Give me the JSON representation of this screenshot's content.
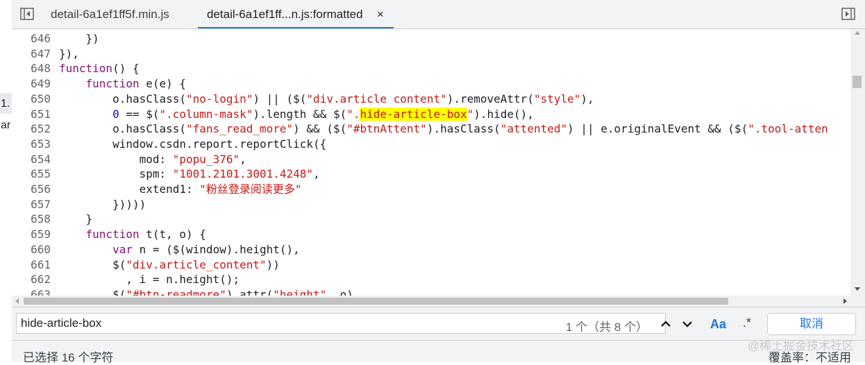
{
  "tabs": [
    {
      "label": "detail-6a1ef1ff5f.min.js",
      "active": false
    },
    {
      "label": "detail-6a1ef1ff...n.js:formatted",
      "active": true,
      "close": "×"
    }
  ],
  "left_strip": {
    "item1": "1.",
    "item2": "ar"
  },
  "code_lines": [
    {
      "n": "646",
      "html": "    })"
    },
    {
      "n": "647",
      "html": "}),"
    },
    {
      "n": "648",
      "html": "<span class=\"kw\">function</span>() {"
    },
    {
      "n": "649",
      "html": "    <span class=\"kw\">function</span> e(e) {"
    },
    {
      "n": "650",
      "html": "        o.hasClass(<span class=\"str\">\"no-login\"</span>) || ($(<span class=\"str\">\"div.article content\"</span>).removeAttr(<span class=\"str\">\"style\"</span>),"
    },
    {
      "n": "651",
      "html": "        <span class=\"num\">0</span> == $(<span class=\"str\">\".column-mask\"</span>).length && $(<span class=\"str\">\".<span class=\"hl\">hide-article-box</span>\"</span>).hide(),"
    },
    {
      "n": "652",
      "html": "        o.hasClass(<span class=\"str\">\"fans_read_more\"</span>) && ($(<span class=\"str\">\"#btnAttent\"</span>).hasClass(<span class=\"str\">\"attented\"</span>) || e.originalEvent && ($(<span class=\"str\">\".tool-atten</span>"
    },
    {
      "n": "653",
      "html": "        window.csdn.report.reportClick({"
    },
    {
      "n": "654",
      "html": "            mod: <span class=\"str\">\"popu_376\"</span>,"
    },
    {
      "n": "655",
      "html": "            spm: <span class=\"str\">\"1001.2101.3001.4248\"</span>,"
    },
    {
      "n": "656",
      "html": "            extend1: <span class=\"str\">\"粉丝登录阅读更多\"</span>"
    },
    {
      "n": "657",
      "html": "        }))))"
    },
    {
      "n": "658",
      "html": "    }"
    },
    {
      "n": "659",
      "html": "    <span class=\"kw\">function</span> t(t, o) {"
    },
    {
      "n": "660",
      "html": "        <span class=\"kw\">var</span> n = ($(window).height(),"
    },
    {
      "n": "661",
      "html": "        $(<span class=\"str\">\"div.article_content\"</span>))"
    },
    {
      "n": "662",
      "html": "          , i = n.height();"
    },
    {
      "n": "663",
      "html": "        $(<span class=\"str\">\"#btn-readmore\"</span>).attr(<span class=\"str\">\"height\"</span>, o)"
    }
  ],
  "search": {
    "query": "hide-article-box",
    "match_count": "1 个（共 8 个）",
    "case_label": "Aa",
    "regex_label": ".*",
    "cancel_label": "取消"
  },
  "status": {
    "selection": "已选择 16 个字符",
    "coverage": "覆盖率：不适用",
    "watermark": "@稀土掘金技术社区"
  },
  "colors": {
    "accent": "#1a73e8",
    "keyword": "#881280",
    "string": "#c41a16",
    "number": "#1c00cf",
    "highlight": "#ffff00"
  }
}
